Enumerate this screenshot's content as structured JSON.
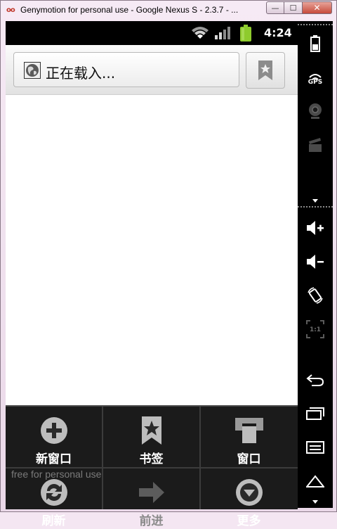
{
  "window": {
    "title": "Genymotion for personal use - Google Nexus S - 2.3.7 - ...",
    "icon_glyph": "oo",
    "minimize_glyph": "—",
    "maximize_glyph": "☐",
    "close_glyph": "✕"
  },
  "statusbar": {
    "time": "4:24",
    "icons": [
      "wifi-icon",
      "signal-icon",
      "battery-icon"
    ]
  },
  "browser": {
    "url_text": "正在载入...",
    "icons": [
      "globe-icon",
      "bookmark-star-icon"
    ]
  },
  "menu": {
    "items": [
      {
        "label": "新窗口",
        "icon": "plus-circle-icon"
      },
      {
        "label": "书签",
        "icon": "bookmark-icon"
      },
      {
        "label": "窗口",
        "icon": "windows-icon"
      },
      {
        "label": "刷新",
        "icon": "refresh-icon"
      },
      {
        "label": "前进",
        "icon": "forward-arrow-icon"
      },
      {
        "label": "更多",
        "icon": "more-chevron-icon"
      }
    ]
  },
  "watermark": "free for personal use",
  "sidebar": {
    "gps_label": "GPS",
    "pixel_label": "1:1",
    "icons": [
      "battery-icon",
      "gps-icon",
      "webcam-icon",
      "clapper-icon",
      "dropdown-arrow-icon",
      "volume-up-icon",
      "volume-down-icon",
      "rotate-icon",
      "pixel-perfect-icon",
      "back-icon",
      "recent-apps-icon",
      "menu-icon",
      "home-icon",
      "dropdown-arrow-icon"
    ]
  },
  "colors": {
    "menu_bg": "#1b1b1b",
    "battery_green": "#8ecb2d",
    "close_red": "#c64a3a"
  }
}
